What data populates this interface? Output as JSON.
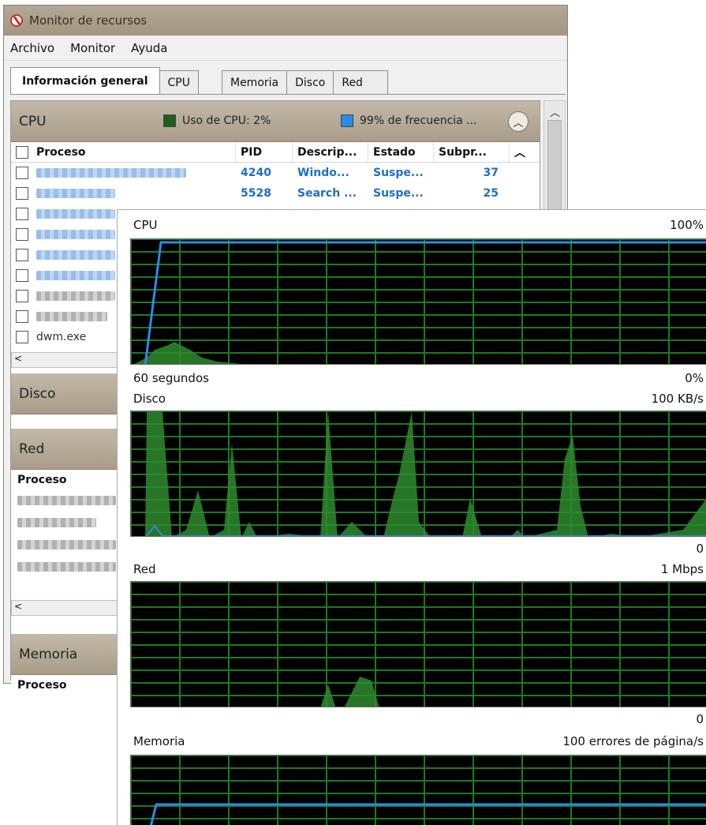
{
  "window": {
    "title": "Monitor de recursos"
  },
  "menu": [
    "Archivo",
    "Monitor",
    "Ayuda"
  ],
  "tabs": [
    "Información general",
    "CPU",
    "Memoria",
    "Disco",
    "Red"
  ],
  "cpu_section": {
    "title": "CPU",
    "legend_usage": "Uso de CPU: 2%",
    "legend_freq": "99% de frecuencia ...",
    "legend_usage_color": "#1e5e1e",
    "legend_freq_color": "#2b8be6",
    "columns": [
      "Proceso",
      "PID",
      "Descrip...",
      "Estado",
      "Subpr..."
    ],
    "rows": [
      {
        "pid": "4240",
        "desc": "Windo...",
        "state": "Suspe...",
        "threads": "37"
      },
      {
        "pid": "5528",
        "desc": "Search ...",
        "state": "Suspe...",
        "threads": "25"
      }
    ],
    "last_process": "dwm.exe"
  },
  "disk_section": {
    "title": "Disco"
  },
  "net_section": {
    "title": "Red",
    "column": "Proceso"
  },
  "mem_section": {
    "title": "Memoria",
    "column": "Proceso"
  },
  "graphs": {
    "cpu": {
      "title": "CPU",
      "max": "100%",
      "time": "60 segundos",
      "min": "0%"
    },
    "disk": {
      "title": "Disco",
      "max": "100 KB/s",
      "min": "0"
    },
    "net": {
      "title": "Red",
      "max": "1 Mbps",
      "min": "0"
    },
    "mem": {
      "title": "Memoria",
      "max": "100 errores de página/s"
    }
  },
  "colors": {
    "grid": "#1f7a1f",
    "fill": "#2e8b2e",
    "line_blue": "#2b8be6",
    "graph_bg": "#000000"
  }
}
